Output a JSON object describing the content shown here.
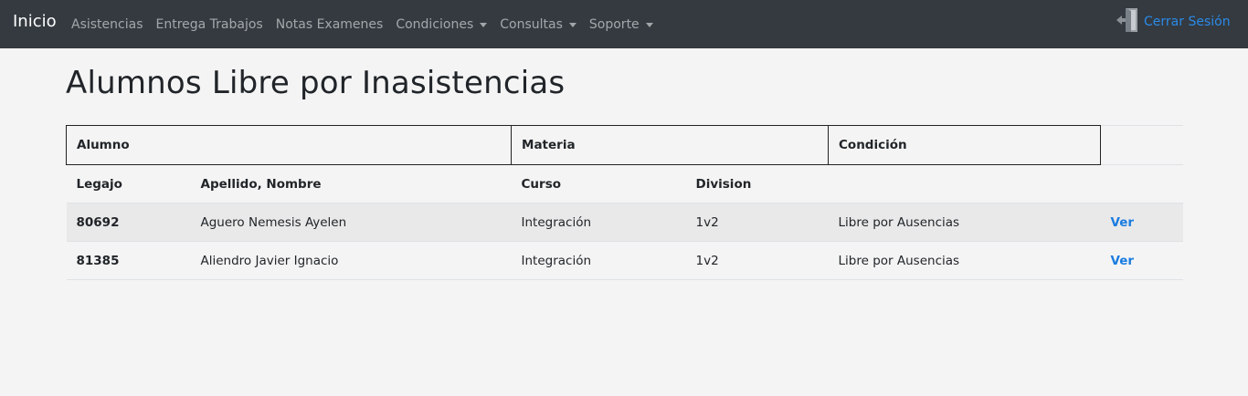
{
  "navbar": {
    "brand": "Inicio",
    "items": [
      {
        "label": "Asistencias",
        "dropdown": false
      },
      {
        "label": "Entrega Trabajos",
        "dropdown": false
      },
      {
        "label": "Notas Examenes",
        "dropdown": false
      },
      {
        "label": "Condiciones",
        "dropdown": true
      },
      {
        "label": "Consultas",
        "dropdown": true
      },
      {
        "label": "Soporte",
        "dropdown": true
      }
    ],
    "logout_label": "Cerrar Sesión",
    "logout_icon": "door-exit-icon"
  },
  "page": {
    "title": "Alumnos Libre por Inasistencias"
  },
  "table": {
    "groups": [
      "Alumno",
      "Materia",
      "Condición"
    ],
    "columns": [
      "Legajo",
      "Apellido, Nombre",
      "Curso",
      "Division"
    ],
    "rows": [
      {
        "legajo": "80692",
        "nombre": "Aguero Nemesis Ayelen",
        "curso": "Integración",
        "division": "1v2",
        "condicion": "Libre por Ausencias",
        "action": "Ver"
      },
      {
        "legajo": "81385",
        "nombre": "Aliendro Javier Ignacio",
        "curso": "Integración",
        "division": "1v2",
        "condicion": "Libre por Ausencias",
        "action": "Ver"
      }
    ]
  },
  "colors": {
    "navbar_bg": "#343a40",
    "link": "#1a7ce0",
    "page_bg": "#f4f4f4"
  }
}
